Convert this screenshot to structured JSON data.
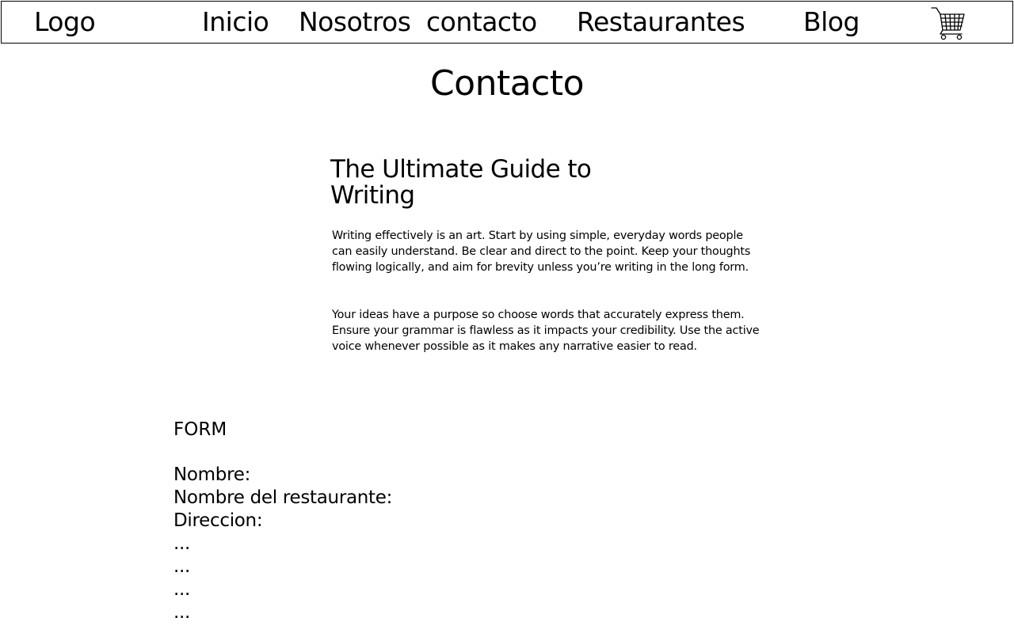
{
  "header": {
    "logo": "Logo",
    "nav_items": [
      {
        "label": "Inicio"
      },
      {
        "label": "Nosotros"
      },
      {
        "label": "contacto"
      },
      {
        "label": "Restaurantes"
      },
      {
        "label": "Blog"
      }
    ],
    "cart_icon": "shopping-cart-icon"
  },
  "main": {
    "title": "Contacto",
    "article": {
      "heading": "The Ultimate Guide to Writing",
      "paragraphs": [
        "Writing effectively is an art. Start by using simple, everyday words people can easily understand. Be clear and direct to the point. Keep your thoughts flowing logically, and aim for brevity unless you’re writing in the long form.",
        "Your ideas have a purpose so choose words that accurately express them. Ensure your grammar is flawless as it impacts your credibility. Use the active voice whenever possible as it makes any narrative easier to read."
      ]
    }
  },
  "form": {
    "label": "FORM",
    "fields": [
      {
        "label": "Nombre:"
      },
      {
        "label": "Nombre del restaurante:"
      },
      {
        "label": "Direccion:"
      },
      {
        "label": "..."
      },
      {
        "label": "..."
      },
      {
        "label": "..."
      },
      {
        "label": "..."
      }
    ]
  }
}
